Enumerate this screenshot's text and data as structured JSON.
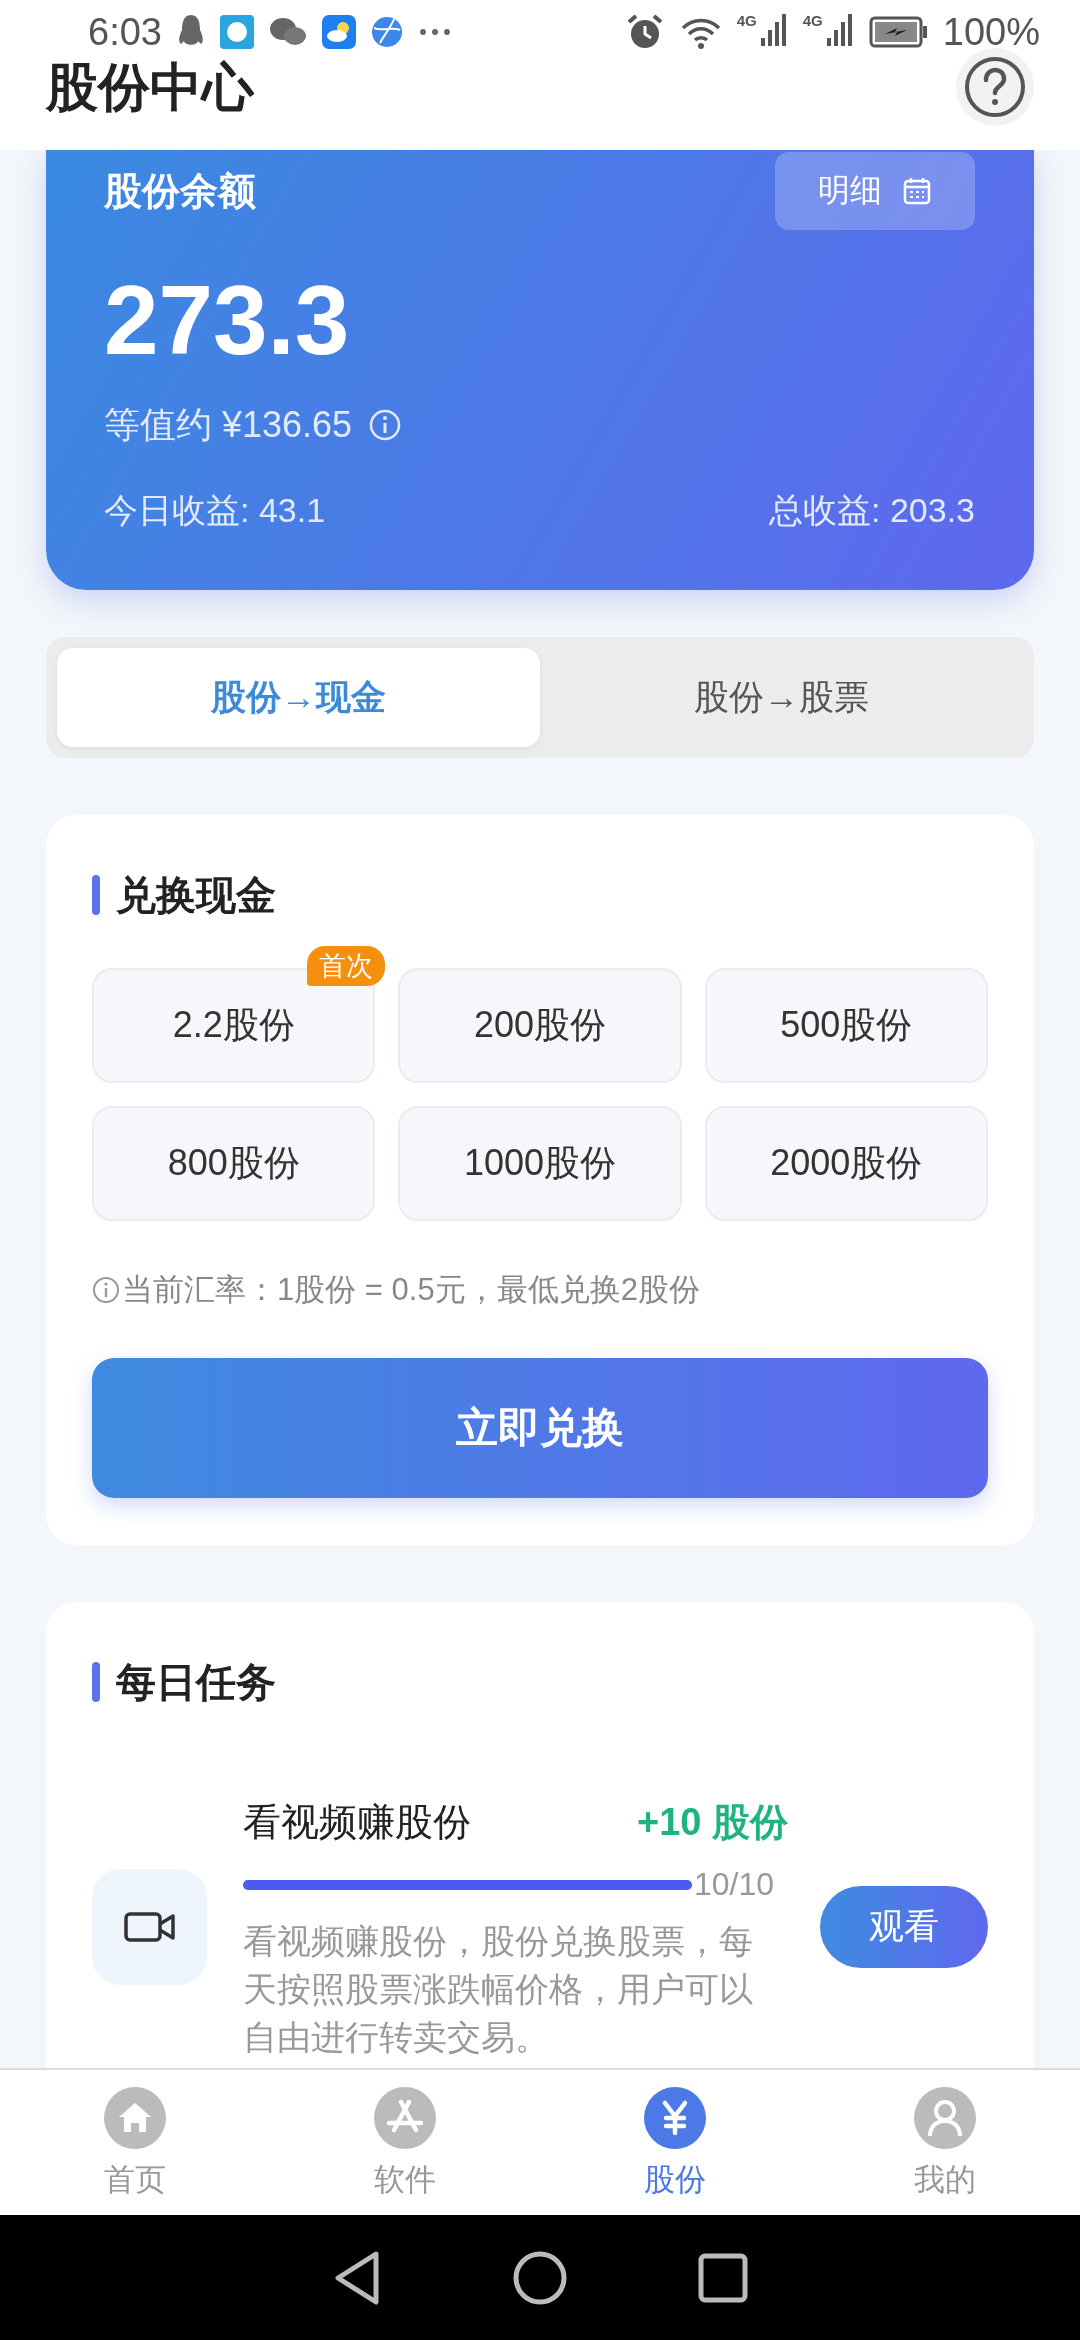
{
  "status_bar": {
    "time": "6:03",
    "networks": [
      "4G",
      "4G"
    ],
    "battery": "100%"
  },
  "header": {
    "title": "股份中心"
  },
  "balance_card": {
    "title": "股份余额",
    "detail_button": "明细",
    "amount": "273.3",
    "equivalent": "等值约 ¥136.65",
    "today_income": "今日收益: 43.1",
    "total_income": "总收益: 203.3"
  },
  "tabs": [
    {
      "label": "股份→现金",
      "selected": true
    },
    {
      "label": "股份→股票",
      "selected": false
    }
  ],
  "exchange": {
    "title": "兑换现金",
    "options": [
      {
        "label": "2.2股份",
        "badge": "首次"
      },
      {
        "label": "200股份"
      },
      {
        "label": "500股份"
      },
      {
        "label": "800股份"
      },
      {
        "label": "1000股份"
      },
      {
        "label": "2000股份"
      }
    ],
    "note": "当前汇率：1股份 = 0.5元，最低兑换2股份",
    "button": "立即兑换"
  },
  "daily_tasks": {
    "title": "每日任务",
    "tasks": [
      {
        "title": "看视频赚股份",
        "reward": "+10 股份",
        "level": 1.0,
        "reading": "10/10",
        "description": "看视频赚股份，股份兑换股票，每天按照股票涨跌幅价格，用户可以自由进行转卖交易。",
        "button": "观看"
      }
    ]
  },
  "bottom_nav": [
    {
      "label": "首页",
      "kind": "home",
      "selected": false
    },
    {
      "label": "软件",
      "kind": "apps",
      "selected": false
    },
    {
      "label": "股份",
      "kind": "yen",
      "selected": true
    },
    {
      "label": "我的",
      "kind": "user",
      "selected": false
    }
  ]
}
